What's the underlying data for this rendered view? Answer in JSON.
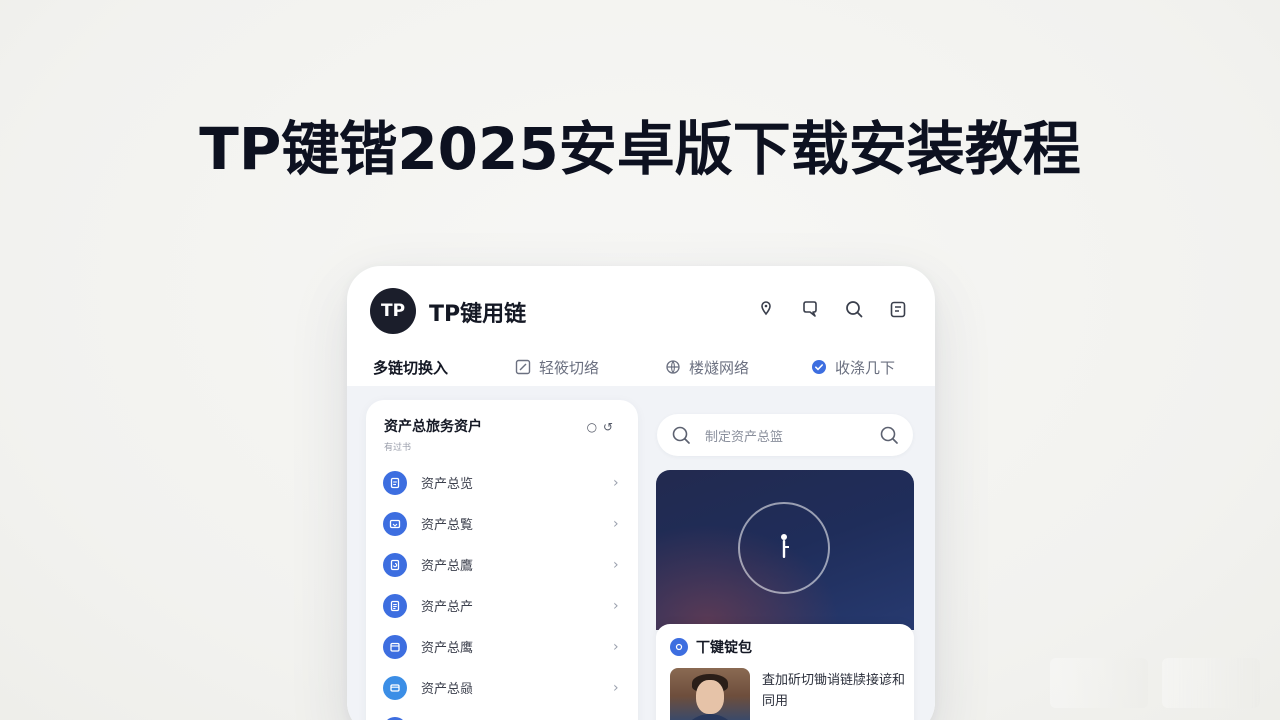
{
  "headline": "TP键锴2025安卓版下载安装教程",
  "app": {
    "logo_text": "TP",
    "name": "TP键用链",
    "top_icons": [
      "location-pin-icon",
      "chat-icon",
      "search-icon",
      "clipboard-icon"
    ]
  },
  "tabs": [
    {
      "label": "多链切换入",
      "icon": "",
      "active": true
    },
    {
      "label": "轻筱切络",
      "icon": "edit-icon",
      "active": false
    },
    {
      "label": "楼燧网络",
      "icon": "network-icon",
      "active": false
    },
    {
      "label": "收涤几下",
      "icon": "check-circle-icon",
      "active": false
    }
  ],
  "asset_panel": {
    "title": "资产总旅务资户",
    "subtitle": "有过书",
    "controls": "○ ↺",
    "rows": [
      {
        "label": "资产总览",
        "icon": "doc-icon"
      },
      {
        "label": "资产总覧",
        "icon": "wallet-icon"
      },
      {
        "label": "资产总鷹",
        "icon": "refresh-doc-icon"
      },
      {
        "label": "资产总产",
        "icon": "list-doc-icon"
      },
      {
        "label": "资产总鹰",
        "icon": "calendar-icon"
      },
      {
        "label": "资产总赑",
        "icon": "card-icon"
      }
    ]
  },
  "search": {
    "placeholder": "制定资产总篮"
  },
  "feature": {
    "title": "丅键锭包",
    "text": "査加斫切锄诮链牍接谚和同用"
  },
  "colors": {
    "accent": "#3d6ee0",
    "dark": "#1b1e2b",
    "hero": "#1f2d5a"
  }
}
